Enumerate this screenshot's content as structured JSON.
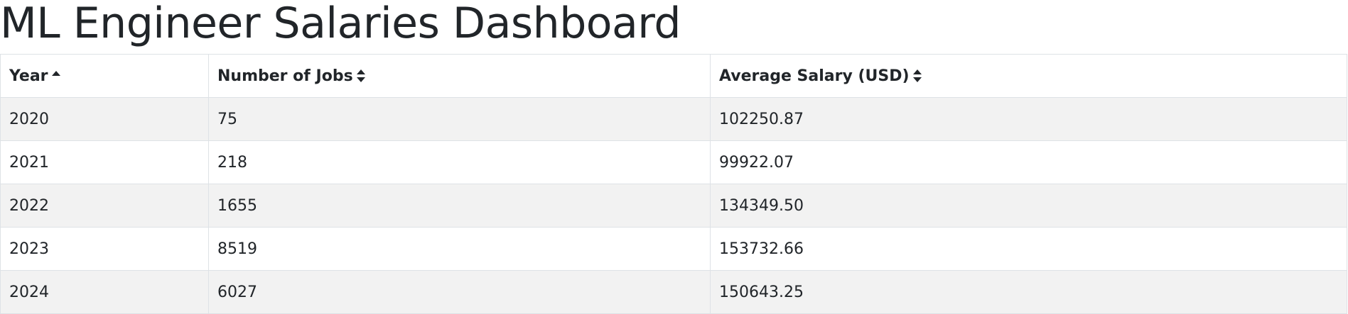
{
  "page": {
    "title": "ML Engineer Salaries Dashboard"
  },
  "table": {
    "columns": [
      {
        "label": "Year",
        "sort_icon": "sort-up-icon"
      },
      {
        "label": "Number of Jobs",
        "sort_icon": "sort-icon"
      },
      {
        "label": "Average Salary (USD)",
        "sort_icon": "sort-icon"
      }
    ],
    "rows": [
      {
        "year": "2020",
        "jobs": "75",
        "salary": "102250.87"
      },
      {
        "year": "2021",
        "jobs": "218",
        "salary": "99922.07"
      },
      {
        "year": "2022",
        "jobs": "1655",
        "salary": "134349.50"
      },
      {
        "year": "2023",
        "jobs": "8519",
        "salary": "153732.66"
      },
      {
        "year": "2024",
        "jobs": "6027",
        "salary": "150643.25"
      }
    ]
  }
}
